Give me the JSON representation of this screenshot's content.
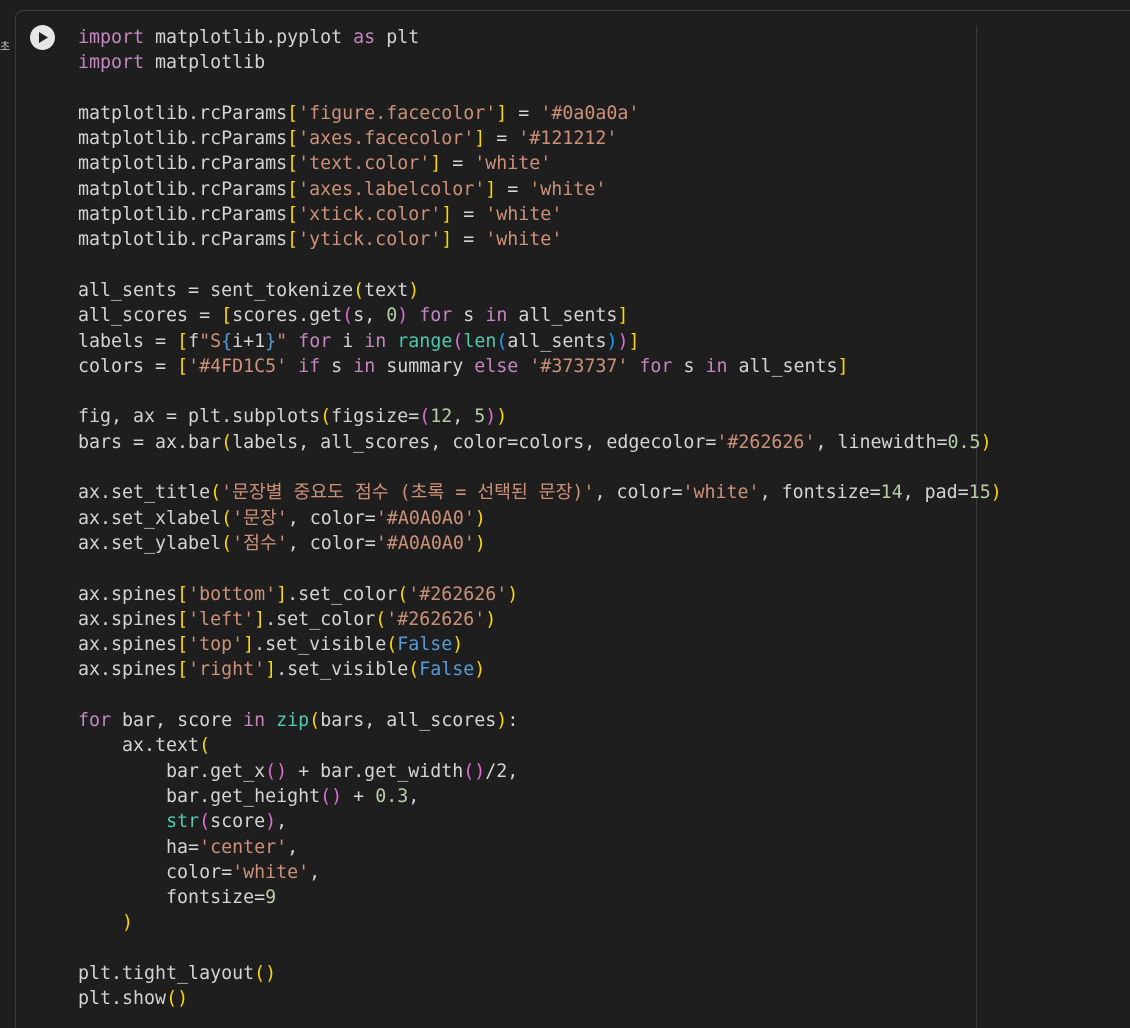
{
  "gutter": {
    "label": "초"
  },
  "cell": {
    "run_button_icon": "play-icon",
    "colors": {
      "keyword": "#c586c0",
      "default": "#d4d4d4",
      "string": "#ce9178",
      "number": "#b5cea8",
      "builtin": "#4ec9b0",
      "constant": "#569cd6",
      "operator": "#569cd6",
      "bracket1": "#ffd700",
      "bracket2": "#da70d6",
      "bracket3": "#179fff"
    },
    "code_lines": [
      [
        [
          "keyword",
          "import"
        ],
        [
          "default",
          " matplotlib.pyplot "
        ],
        [
          "keyword",
          "as"
        ],
        [
          "default",
          " plt"
        ]
      ],
      [
        [
          "keyword",
          "import"
        ],
        [
          "default",
          " matplotlib"
        ]
      ],
      [],
      [
        [
          "default",
          "matplotlib.rcParams"
        ],
        [
          "bracket1",
          "["
        ],
        [
          "string",
          "'figure.facecolor'"
        ],
        [
          "bracket1",
          "]"
        ],
        [
          "default",
          " = "
        ],
        [
          "string",
          "'#0a0a0a'"
        ]
      ],
      [
        [
          "default",
          "matplotlib.rcParams"
        ],
        [
          "bracket1",
          "["
        ],
        [
          "string",
          "'axes.facecolor'"
        ],
        [
          "bracket1",
          "]"
        ],
        [
          "default",
          " = "
        ],
        [
          "string",
          "'#121212'"
        ]
      ],
      [
        [
          "default",
          "matplotlib.rcParams"
        ],
        [
          "bracket1",
          "["
        ],
        [
          "string",
          "'text.color'"
        ],
        [
          "bracket1",
          "]"
        ],
        [
          "default",
          " = "
        ],
        [
          "string",
          "'white'"
        ]
      ],
      [
        [
          "default",
          "matplotlib.rcParams"
        ],
        [
          "bracket1",
          "["
        ],
        [
          "string",
          "'axes.labelcolor'"
        ],
        [
          "bracket1",
          "]"
        ],
        [
          "default",
          " = "
        ],
        [
          "string",
          "'white'"
        ]
      ],
      [
        [
          "default",
          "matplotlib.rcParams"
        ],
        [
          "bracket1",
          "["
        ],
        [
          "string",
          "'xtick.color'"
        ],
        [
          "bracket1",
          "]"
        ],
        [
          "default",
          " = "
        ],
        [
          "string",
          "'white'"
        ]
      ],
      [
        [
          "default",
          "matplotlib.rcParams"
        ],
        [
          "bracket1",
          "["
        ],
        [
          "string",
          "'ytick.color'"
        ],
        [
          "bracket1",
          "]"
        ],
        [
          "default",
          " = "
        ],
        [
          "string",
          "'white'"
        ]
      ],
      [],
      [
        [
          "default",
          "all_sents = sent_tokenize"
        ],
        [
          "bracket1",
          "("
        ],
        [
          "default",
          "text"
        ],
        [
          "bracket1",
          ")"
        ]
      ],
      [
        [
          "default",
          "all_scores = "
        ],
        [
          "bracket1",
          "["
        ],
        [
          "default",
          "scores.get"
        ],
        [
          "bracket2",
          "("
        ],
        [
          "default",
          "s, "
        ],
        [
          "number",
          "0"
        ],
        [
          "bracket2",
          ")"
        ],
        [
          "default",
          " "
        ],
        [
          "keyword",
          "for"
        ],
        [
          "default",
          " s "
        ],
        [
          "keyword",
          "in"
        ],
        [
          "default",
          " all_sents"
        ],
        [
          "bracket1",
          "]"
        ]
      ],
      [
        [
          "default",
          "labels = "
        ],
        [
          "bracket1",
          "["
        ],
        [
          "default",
          "f"
        ],
        [
          "string",
          "\"S"
        ],
        [
          "operator",
          "{"
        ],
        [
          "default",
          "i+1"
        ],
        [
          "operator",
          "}"
        ],
        [
          "string",
          "\""
        ],
        [
          "default",
          " "
        ],
        [
          "keyword",
          "for"
        ],
        [
          "default",
          " i "
        ],
        [
          "keyword",
          "in"
        ],
        [
          "default",
          " "
        ],
        [
          "builtin",
          "range"
        ],
        [
          "bracket2",
          "("
        ],
        [
          "builtin",
          "len"
        ],
        [
          "bracket3",
          "("
        ],
        [
          "default",
          "all_sents"
        ],
        [
          "bracket3",
          ")"
        ],
        [
          "bracket2",
          ")"
        ],
        [
          "bracket1",
          "]"
        ]
      ],
      [
        [
          "default",
          "colors = "
        ],
        [
          "bracket1",
          "["
        ],
        [
          "string",
          "'#4FD1C5'"
        ],
        [
          "default",
          " "
        ],
        [
          "keyword",
          "if"
        ],
        [
          "default",
          " s "
        ],
        [
          "keyword",
          "in"
        ],
        [
          "default",
          " summary "
        ],
        [
          "keyword",
          "else"
        ],
        [
          "default",
          " "
        ],
        [
          "string",
          "'#373737'"
        ],
        [
          "default",
          " "
        ],
        [
          "keyword",
          "for"
        ],
        [
          "default",
          " s "
        ],
        [
          "keyword",
          "in"
        ],
        [
          "default",
          " all_sents"
        ],
        [
          "bracket1",
          "]"
        ]
      ],
      [],
      [
        [
          "default",
          "fig, ax = plt.subplots"
        ],
        [
          "bracket1",
          "("
        ],
        [
          "default",
          "figsize="
        ],
        [
          "bracket2",
          "("
        ],
        [
          "number",
          "12"
        ],
        [
          "default",
          ", "
        ],
        [
          "number",
          "5"
        ],
        [
          "bracket2",
          ")"
        ],
        [
          "bracket1",
          ")"
        ]
      ],
      [
        [
          "default",
          "bars = ax.bar"
        ],
        [
          "bracket1",
          "("
        ],
        [
          "default",
          "labels, all_scores, color=colors, edgecolor="
        ],
        [
          "string",
          "'#262626'"
        ],
        [
          "default",
          ", linewidth="
        ],
        [
          "number",
          "0.5"
        ],
        [
          "bracket1",
          ")"
        ]
      ],
      [],
      [
        [
          "default",
          "ax.set_title"
        ],
        [
          "bracket1",
          "("
        ],
        [
          "string",
          "'문장별 중요도 점수 (초록 = 선택된 문장)'"
        ],
        [
          "default",
          ", color="
        ],
        [
          "string",
          "'white'"
        ],
        [
          "default",
          ", fontsize="
        ],
        [
          "number",
          "14"
        ],
        [
          "default",
          ", pad="
        ],
        [
          "number",
          "15"
        ],
        [
          "bracket1",
          ")"
        ]
      ],
      [
        [
          "default",
          "ax.set_xlabel"
        ],
        [
          "bracket1",
          "("
        ],
        [
          "string",
          "'문장'"
        ],
        [
          "default",
          ", color="
        ],
        [
          "string",
          "'#A0A0A0'"
        ],
        [
          "bracket1",
          ")"
        ]
      ],
      [
        [
          "default",
          "ax.set_ylabel"
        ],
        [
          "bracket1",
          "("
        ],
        [
          "string",
          "'점수'"
        ],
        [
          "default",
          ", color="
        ],
        [
          "string",
          "'#A0A0A0'"
        ],
        [
          "bracket1",
          ")"
        ]
      ],
      [],
      [
        [
          "default",
          "ax.spines"
        ],
        [
          "bracket1",
          "["
        ],
        [
          "string",
          "'bottom'"
        ],
        [
          "bracket1",
          "]"
        ],
        [
          "default",
          ".set_color"
        ],
        [
          "bracket1",
          "("
        ],
        [
          "string",
          "'#262626'"
        ],
        [
          "bracket1",
          ")"
        ]
      ],
      [
        [
          "default",
          "ax.spines"
        ],
        [
          "bracket1",
          "["
        ],
        [
          "string",
          "'left'"
        ],
        [
          "bracket1",
          "]"
        ],
        [
          "default",
          ".set_color"
        ],
        [
          "bracket1",
          "("
        ],
        [
          "string",
          "'#262626'"
        ],
        [
          "bracket1",
          ")"
        ]
      ],
      [
        [
          "default",
          "ax.spines"
        ],
        [
          "bracket1",
          "["
        ],
        [
          "string",
          "'top'"
        ],
        [
          "bracket1",
          "]"
        ],
        [
          "default",
          ".set_visible"
        ],
        [
          "bracket1",
          "("
        ],
        [
          "constant",
          "False"
        ],
        [
          "bracket1",
          ")"
        ]
      ],
      [
        [
          "default",
          "ax.spines"
        ],
        [
          "bracket1",
          "["
        ],
        [
          "string",
          "'right'"
        ],
        [
          "bracket1",
          "]"
        ],
        [
          "default",
          ".set_visible"
        ],
        [
          "bracket1",
          "("
        ],
        [
          "constant",
          "False"
        ],
        [
          "bracket1",
          ")"
        ]
      ],
      [],
      [
        [
          "keyword",
          "for"
        ],
        [
          "default",
          " bar, score "
        ],
        [
          "keyword",
          "in"
        ],
        [
          "default",
          " "
        ],
        [
          "builtin",
          "zip"
        ],
        [
          "bracket1",
          "("
        ],
        [
          "default",
          "bars, all_scores"
        ],
        [
          "bracket1",
          ")"
        ],
        [
          "default",
          ":"
        ]
      ],
      [
        [
          "default",
          "    ax.text"
        ],
        [
          "bracket1",
          "("
        ]
      ],
      [
        [
          "default",
          "        bar.get_x"
        ],
        [
          "bracket2",
          "("
        ],
        [
          "bracket2",
          ")"
        ],
        [
          "default",
          " + bar.get_width"
        ],
        [
          "bracket2",
          "("
        ],
        [
          "bracket2",
          ")"
        ],
        [
          "default",
          "/2,"
        ]
      ],
      [
        [
          "default",
          "        bar.get_height"
        ],
        [
          "bracket2",
          "("
        ],
        [
          "bracket2",
          ")"
        ],
        [
          "default",
          " + "
        ],
        [
          "number",
          "0.3"
        ],
        [
          "default",
          ","
        ]
      ],
      [
        [
          "default",
          "        "
        ],
        [
          "builtin",
          "str"
        ],
        [
          "bracket2",
          "("
        ],
        [
          "default",
          "score"
        ],
        [
          "bracket2",
          ")"
        ],
        [
          "default",
          ","
        ]
      ],
      [
        [
          "default",
          "        ha="
        ],
        [
          "string",
          "'center'"
        ],
        [
          "default",
          ","
        ]
      ],
      [
        [
          "default",
          "        color="
        ],
        [
          "string",
          "'white'"
        ],
        [
          "default",
          ","
        ]
      ],
      [
        [
          "default",
          "        fontsize="
        ],
        [
          "number",
          "9"
        ]
      ],
      [
        [
          "default",
          "    "
        ],
        [
          "bracket1",
          ")"
        ]
      ],
      [],
      [
        [
          "default",
          "plt.tight_layout"
        ],
        [
          "bracket1",
          "("
        ],
        [
          "bracket1",
          ")"
        ]
      ],
      [
        [
          "default",
          "plt.show"
        ],
        [
          "bracket1",
          "("
        ],
        [
          "bracket1",
          ")"
        ]
      ]
    ]
  }
}
